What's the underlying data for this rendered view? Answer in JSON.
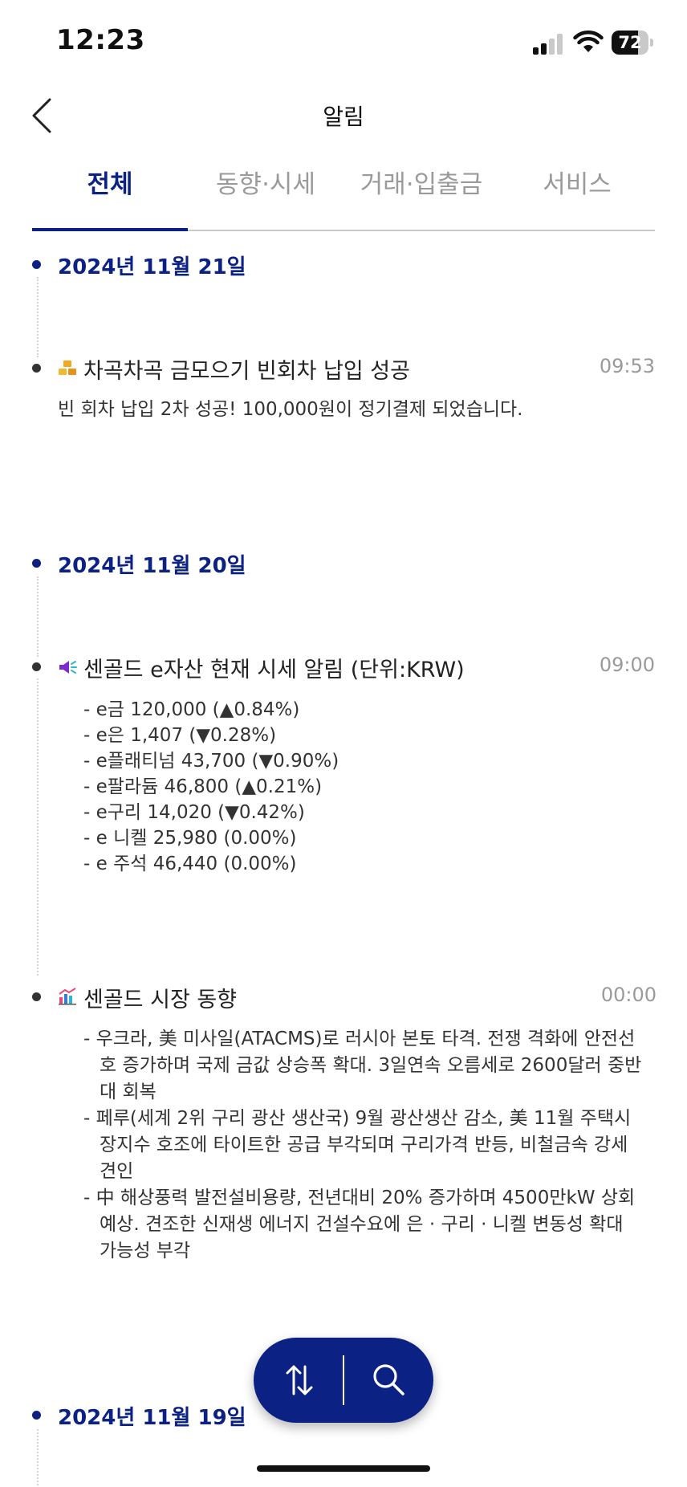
{
  "status_bar": {
    "time": "12:23",
    "battery": "72",
    "battery_level_percent": 72
  },
  "header": {
    "title": "알림"
  },
  "tabs": [
    {
      "label": "전체",
      "active": true
    },
    {
      "label": "동향·시세",
      "active": false
    },
    {
      "label": "거래·입출금",
      "active": false
    },
    {
      "label": "서비스",
      "active": false
    }
  ],
  "feed": {
    "date1": "2024년 11월 21일",
    "n1": {
      "icon": "gold-bars-icon",
      "title": "차곡차곡 금모으기 빈회차 납입 성공",
      "time": "09:53",
      "body": "빈 회차 납입 2차 성공! 100,000원이 정기결제 되었습니다."
    },
    "date2": "2024년 11월 20일",
    "n2": {
      "icon": "megaphone-icon",
      "title": "센골드 e자산 현재 시세 알림 (단위:KRW)",
      "time": "09:00",
      "lines": [
        "- e금  120,000 (▲0.84%)",
        "- e은 1,407 (▼0.28%)",
        "- e플래티넘 43,700 (▼0.90%)",
        "- e팔라듐 46,800 (▲0.21%)",
        "- e구리 14,020 (▼0.42%)",
        "- e 니켈 25,980 (0.00%)",
        "- e 주석 46,440 (0.00%)"
      ]
    },
    "n3": {
      "icon": "chart-icon",
      "title": "센골드 시장 동향",
      "time": "00:00",
      "paras": [
        "- 우크라, 美 미사일(ATACMS)로 러시아 본토 타격. 전쟁 격화에 안전선호 증가하며 국제 금값 상승폭 확대. 3일연속 오름세로 2600달러 중반대 회복",
        "- 페루(세계 2위 구리 광산 생산국) 9월 광산생산 감소, 美 11월 주택시장지수 호조에 타이트한 공급 부각되며 구리가격 반등, 비철금속 강세 견인",
        "- 中 해상풍력 발전설비용량, 전년대비 20% 증가하며 4500만kW 상회 예상. 견조한 신재생 에너지 건설수요에 은 · 구리 · 니켈 변동성 확대 가능성 부각"
      ]
    },
    "date3": "2024년 11월 19일"
  },
  "colors": {
    "accent": "#0b2184",
    "muted": "#9a9a9a",
    "text": "#222222"
  },
  "fab": {
    "sort_icon": "sort-arrows-icon",
    "search_icon": "search-icon"
  }
}
